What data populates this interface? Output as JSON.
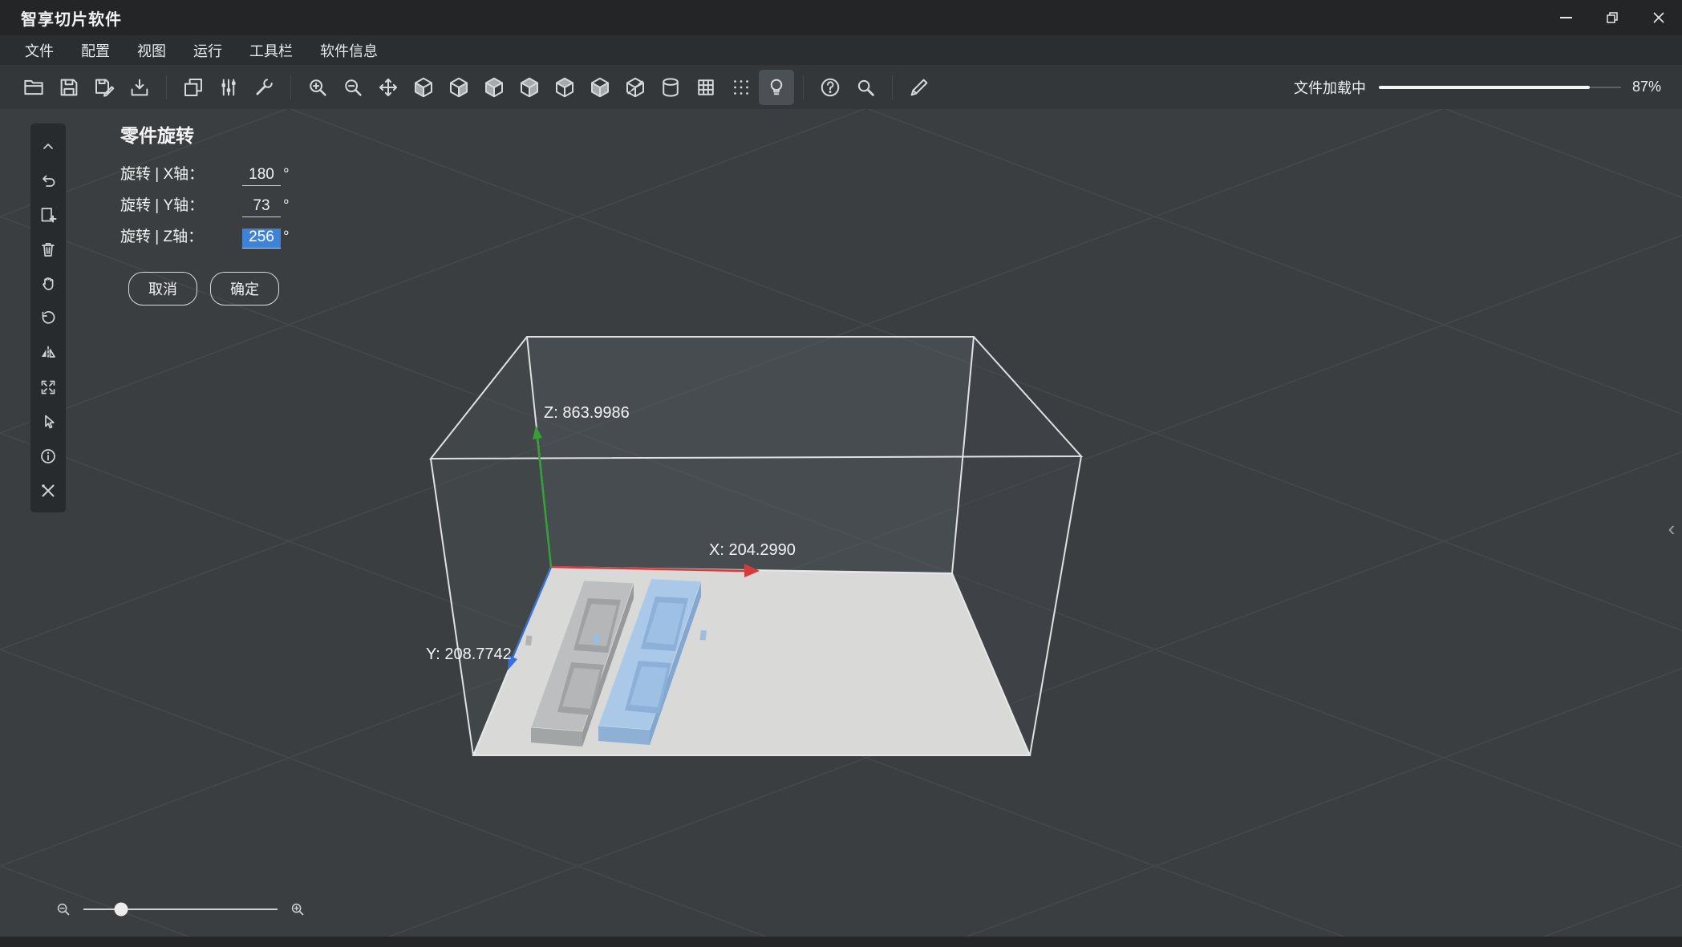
{
  "window": {
    "title": "智享切片软件"
  },
  "menu": {
    "items": [
      "文件",
      "配置",
      "视图",
      "运行",
      "工具栏",
      "软件信息"
    ]
  },
  "toolbar": {
    "progress": {
      "label": "文件加载中",
      "percent_text": "87%",
      "fill_style": "width:87%"
    }
  },
  "rotation_panel": {
    "title": "零件旋转",
    "rows": [
      {
        "label": "旋转 | X轴：",
        "value": "180",
        "unit": "°"
      },
      {
        "label": "旋转 | Y轴：",
        "value": "73",
        "unit": "°"
      },
      {
        "label": "旋转 | Z轴：",
        "value": "256",
        "unit": "°",
        "value_style": "background:#3f83d9;color:#ffffff"
      }
    ],
    "cancel_label": "取消",
    "confirm_label": "确定"
  },
  "viewport": {
    "axis_labels": {
      "x": "X: 204.2990",
      "y": "Y: 208.7742",
      "z": "Z: 863.9986"
    },
    "colors": {
      "x_axis": "#d43c3c",
      "y_axis": "#3a6fd8",
      "z_axis": "#35a035",
      "selection": "#3f83d9",
      "build_plate": "#e0e0de",
      "model_gray": "#bcbec0",
      "model_blue": "#aac8e8"
    }
  },
  "zoom_control": {
    "handle_style": "left:19.4%"
  }
}
